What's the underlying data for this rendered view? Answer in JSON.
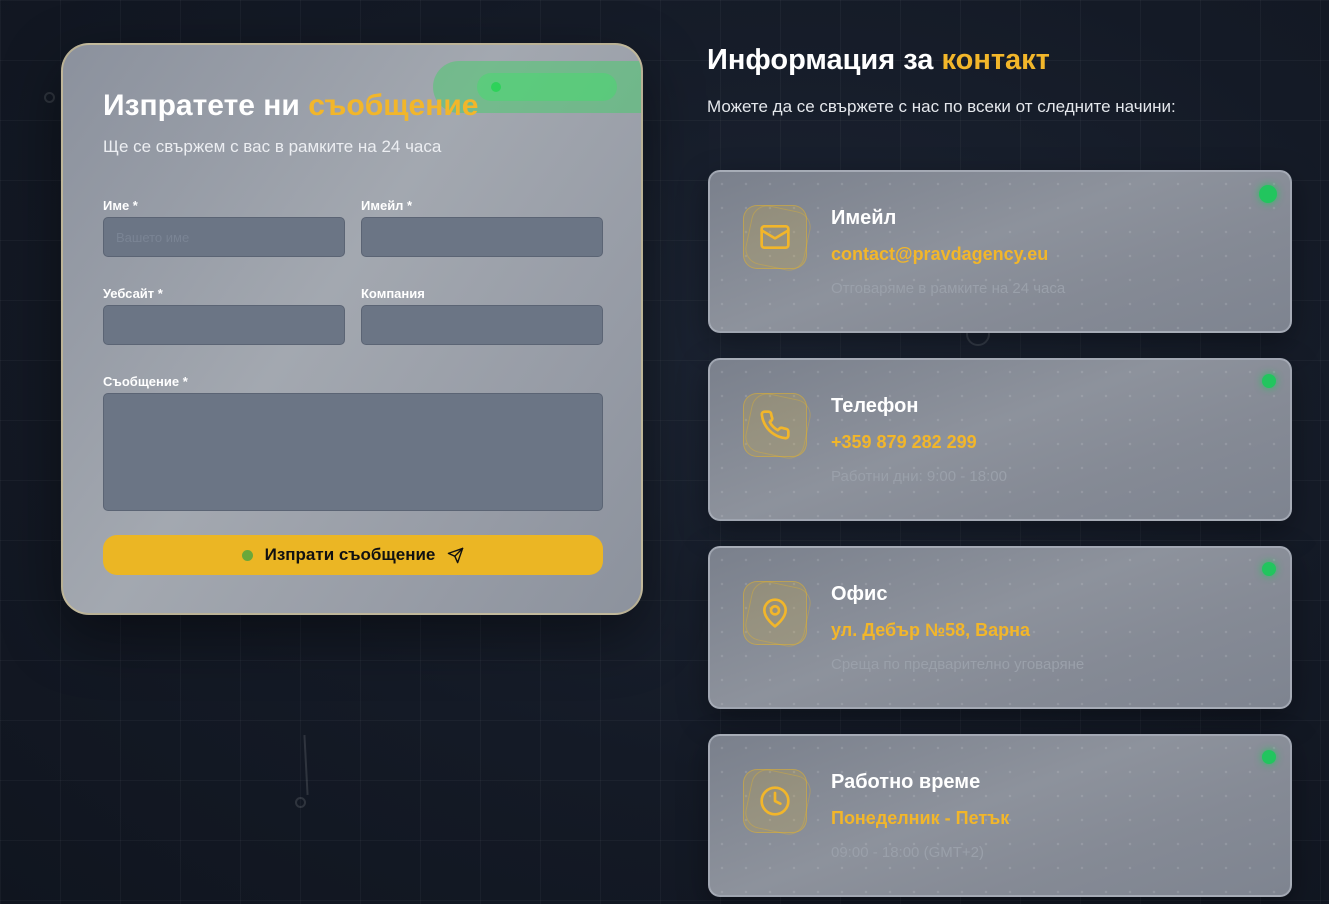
{
  "form": {
    "title_main": "Изпратете ни",
    "title_accent": "съобщение",
    "subtitle": "Ще се свържем с вас в рамките на 24 часа",
    "badge": "",
    "fields": {
      "name": {
        "label": "Име *",
        "placeholder": "Вашето име"
      },
      "email": {
        "label": "Имейл *",
        "placeholder": ""
      },
      "website": {
        "label": "Уебсайт *",
        "placeholder": ""
      },
      "company": {
        "label": "Компания",
        "placeholder": ""
      },
      "message": {
        "label": "Съобщение *",
        "placeholder": ""
      }
    },
    "submit_label": "Изпрати съобщение",
    "submit_icon": "send-icon"
  },
  "info": {
    "title_main": "Информация за",
    "title_accent": "контакт",
    "subtitle": "Можете да се свържете с нас по всеки от следните начини:",
    "cards": [
      {
        "icon": "mail-icon",
        "heading": "Имейл",
        "value": "contact@pravdagency.eu",
        "note": "Отговаряме в рамките на 24 часа"
      },
      {
        "icon": "phone-icon",
        "heading": "Телефон",
        "value": "+359 879 282 299",
        "note": "Работни дни: 9:00 - 18:00"
      },
      {
        "icon": "location-pin-icon",
        "heading": "Офис",
        "value": "ул. Дебър №58, Варна",
        "note": "Среща по предварително уговаряне"
      },
      {
        "icon": "clock-icon",
        "heading": "Работно време",
        "value": "Понеделник - Петък",
        "note": "09:00 - 18:00 (GMT+2)"
      }
    ]
  },
  "colors": {
    "accent": "#f2b62a",
    "button": "#ebb624",
    "status": "#22c55e",
    "background": "#141a26"
  }
}
